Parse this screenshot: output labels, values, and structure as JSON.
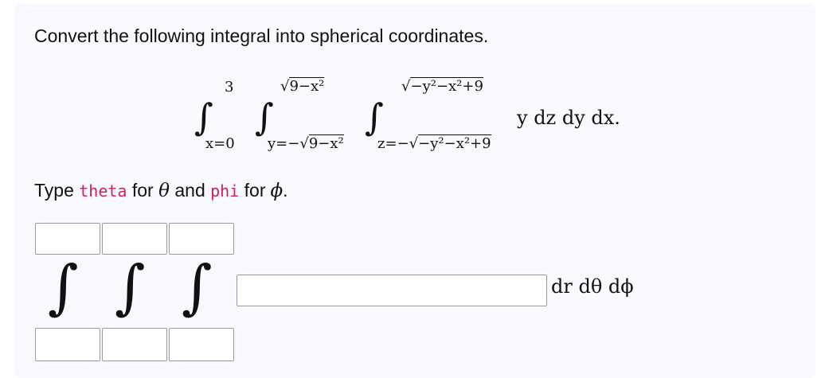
{
  "question": "Convert the following integral into spherical coordinates.",
  "integral": {
    "outer_upper": "3",
    "outer_lower": "x=0",
    "middle_upper": "9−x²",
    "middle_lower_prefix": "y=−",
    "middle_lower_radicand": "9−x²",
    "inner_upper": "−y²−x²+9",
    "inner_lower_prefix": "z=−",
    "inner_lower_radicand": "−y²−x²+9",
    "integrand": "y dz dy dx.",
    "sqrt_symbol": "√",
    "integral_symbol": "∫"
  },
  "instructions": {
    "type_label": "Type",
    "theta_code": "theta",
    "for_label_1": "for",
    "theta_symbol": "θ",
    "and_label": "and",
    "phi_code": "phi",
    "for_label_2": "for",
    "phi_symbol": "ϕ",
    "period": "."
  },
  "answer": {
    "integral_symbol": "∫",
    "upper_limit_values": [
      "",
      "",
      ""
    ],
    "lower_limit_values": [
      "",
      "",
      ""
    ],
    "integrand_value": "",
    "differentials": "dr dθ dϕ"
  }
}
